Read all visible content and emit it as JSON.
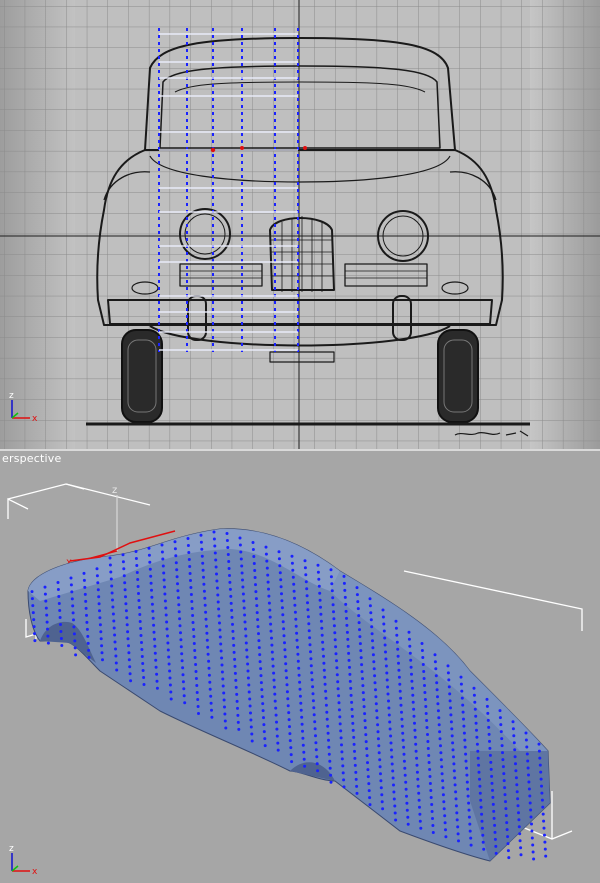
{
  "viewports": {
    "front": {
      "label": "",
      "axis_labels": {
        "up": "z",
        "right": "x"
      }
    },
    "perspective": {
      "label": "erspective",
      "axis_labels": {
        "up": "z",
        "right": "x",
        "gizmo_up": "z",
        "gizmo_x": "x"
      }
    }
  },
  "colors": {
    "viewport_bg": "#a9a9a9",
    "grid_line": "#8a8a8a",
    "grid_major": "#202020",
    "blueprint_ink": "#1a1a1a",
    "vertex_blue": "#1a22ff",
    "selected_edge": "#ffffff",
    "mesh_fill": "#6f87b3",
    "bounding_box": "#ffffff",
    "axis_x": "#e01010",
    "axis_y": "#10c010",
    "axis_z": "#1010d0"
  }
}
